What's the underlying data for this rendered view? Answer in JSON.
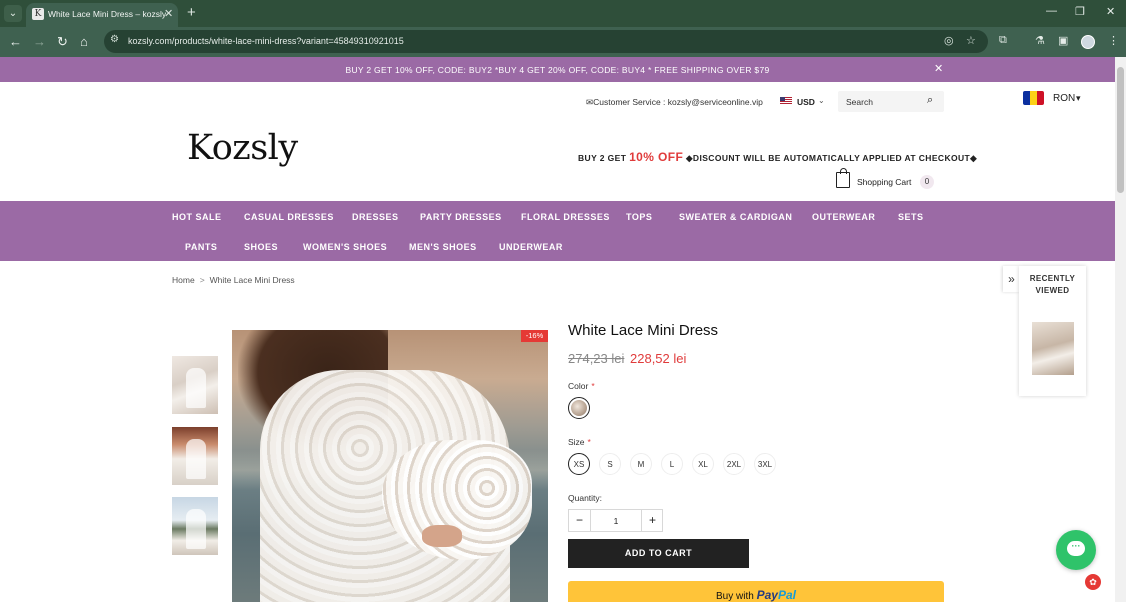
{
  "browser": {
    "tab_title": "White Lace Mini Dress – kozsly",
    "url": "kozsly.com/products/white-lace-mini-dress?variant=45849310921015",
    "icons": [
      "tab-list-icon",
      "favicon",
      "close-tab-icon",
      "new-tab-icon",
      "minimize-icon",
      "restore-icon",
      "close-window-icon",
      "back-icon",
      "forward-icon",
      "reload-icon",
      "home-icon",
      "site-info-icon",
      "eye-off-icon",
      "bookmark-star-icon",
      "extensions-icon",
      "lab-icon",
      "sidepanel-icon",
      "profile-avatar",
      "menu-icon"
    ]
  },
  "promo": {
    "text": "BUY 2 GET 10% OFF, CODE: BUY2 *BUY 4 GET 20% OFF, CODE: BUY4 * FREE SHIPPING OVER $79",
    "background": "#9b6aa5"
  },
  "header": {
    "customer_service": "✉Customer Service : kozsly@serviceonline.vip",
    "currency": "USD",
    "search_placeholder": "Search",
    "locale_currency": "RON",
    "logo": "Kozsly",
    "checkout_note": {
      "prefix": "BUY 2 GET ",
      "highlight": "10% OFF",
      "suffix": " ◆DISCOUNT WILL BE AUTOMATICALLY APPLIED AT CHECKOUT◆"
    },
    "cart_label": "Shopping Cart",
    "cart_count": "0"
  },
  "nav": {
    "row1": [
      "HOT SALE",
      "CASUAL DRESSES",
      "DRESSES",
      "PARTY DRESSES",
      "FLORAL DRESSES",
      "TOPS",
      "SWEATER & CARDIGAN",
      "OUTERWEAR",
      "SETS"
    ],
    "row2": [
      "PANTS",
      "SHOES",
      "WOMEN'S SHOES",
      "MEN'S SHOES",
      "UNDERWEAR"
    ]
  },
  "breadcrumb": {
    "home": "Home",
    "separator": ">",
    "current": "White Lace Mini Dress"
  },
  "product": {
    "title": "White Lace Mini Dress",
    "old_price": "274,23 lei",
    "price": "228,52 lei",
    "discount_badge": "-16%",
    "color_label": "Color",
    "size_label": "Size",
    "required_mark": "*",
    "sizes": [
      "XS",
      "S",
      "M",
      "L",
      "XL",
      "2XL",
      "3XL"
    ],
    "selected_size": "XS",
    "quantity_label": "Quantity:",
    "quantity": "1",
    "qty_minus": "−",
    "qty_plus": "+",
    "add_to_cart": "ADD TO CART",
    "paypal_prefix": "Buy with",
    "paypal_brand_a": "Pay",
    "paypal_brand_b": "Pal"
  },
  "recently_viewed": {
    "title": "RECENTLY VIEWED"
  },
  "colors": {
    "accent": "#9b6aa5",
    "price_red": "#e03b3b",
    "paypal_yellow": "#ffc439",
    "chat_green": "#2fc36a"
  }
}
